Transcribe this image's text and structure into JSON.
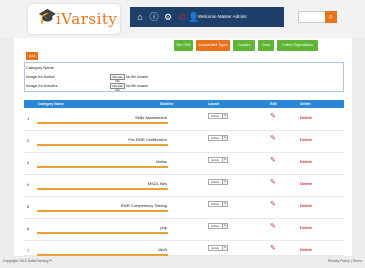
{
  "header": {
    "logo_text": "iVarsity",
    "welcome_text": "Welcome Master Admin!",
    "search": {
      "value": "",
      "placeholder": ""
    }
  },
  "tabs": [
    {
      "label": "Site CMS"
    },
    {
      "label": "Assessment Types"
    },
    {
      "label": "Courses"
    },
    {
      "label": "Tests"
    },
    {
      "label": "Online Organization"
    }
  ],
  "add_button": "Add",
  "form": {
    "category_name_label": "Category Name",
    "image_active_label": "Image for Active",
    "image_inactive_label": "Image for Inactive",
    "choose_file_label": "Choose File",
    "no_file_text": "No file chosen"
  },
  "table": {
    "headers": {
      "category_name": "Category Name",
      "sequence": "Sideline",
      "layout": "Layout",
      "edit": "Edit",
      "delete": "Delete"
    },
    "rows": [
      {
        "num": "1",
        "name": "Skills Assessment",
        "layout": "Active",
        "delete": "Delete"
      },
      {
        "num": "2",
        "name": "Pre-EMR Certification",
        "layout": "Active",
        "delete": "Delete"
      },
      {
        "num": "3",
        "name": "Maths",
        "layout": "Active",
        "delete": "Delete"
      },
      {
        "num": "4",
        "name": "MSDL files",
        "layout": "Active",
        "delete": "Delete"
      },
      {
        "num": "5",
        "name": "EMR Competency Testing",
        "layout": "Active",
        "delete": "Delete"
      },
      {
        "num": "6",
        "name": "php",
        "layout": "Active",
        "delete": "Delete"
      },
      {
        "num": "7",
        "name": "JAVA",
        "layout": "Active",
        "delete": "Delete"
      }
    ]
  },
  "footer": {
    "copyright": "Copyright 2013 SoftaTraining™",
    "links": "Privacy Policy | Terms"
  },
  "colors": {
    "nav": "#1d3f69",
    "accent_orange": "#e8731c",
    "tab_green": "#5fb635",
    "table_header": "#2a86d8",
    "delete_red": "#d12b2b"
  }
}
